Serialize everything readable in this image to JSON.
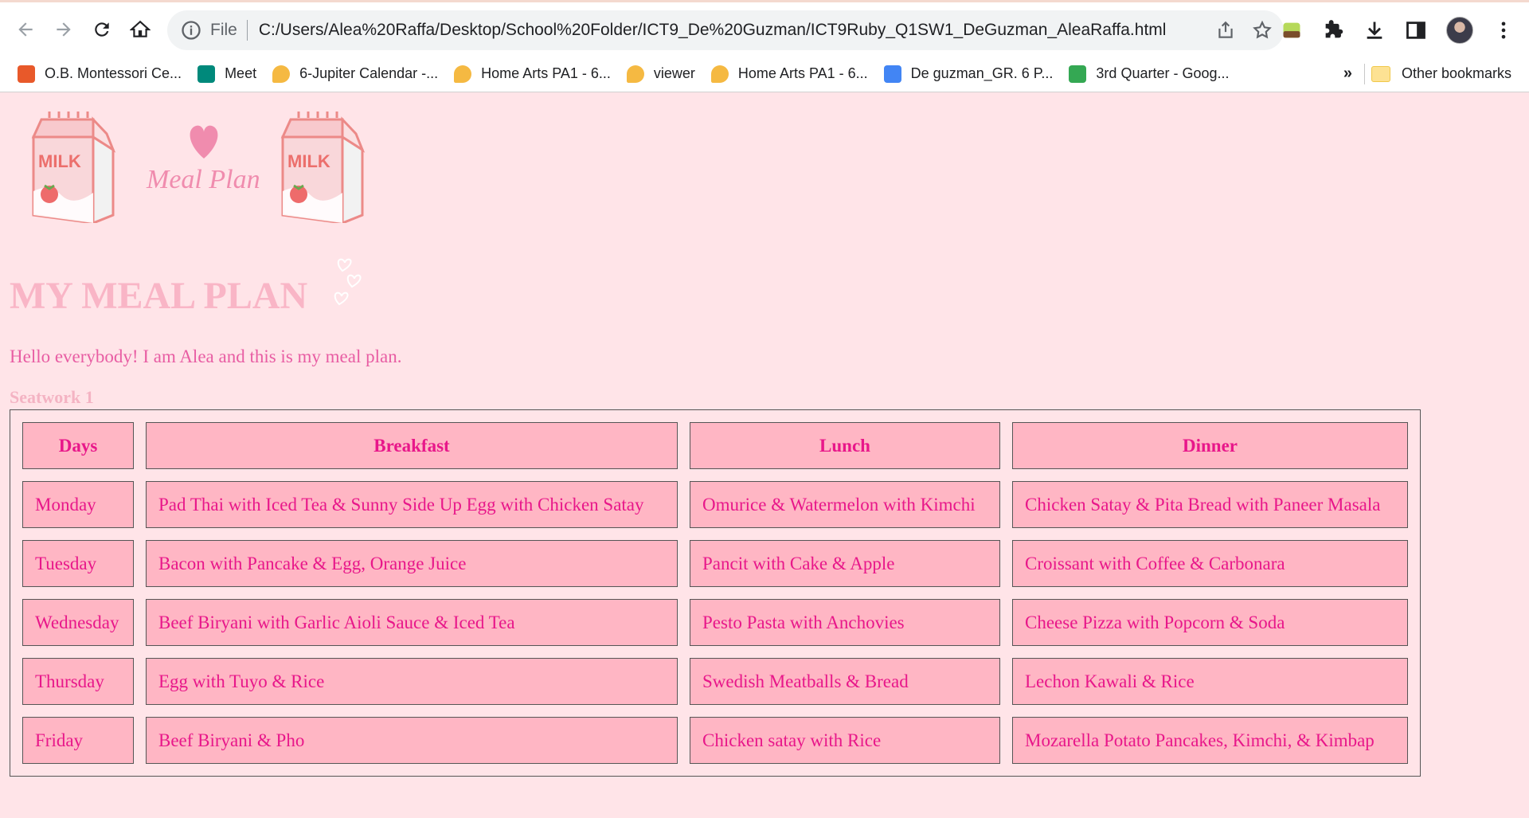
{
  "browser": {
    "file_label": "File",
    "url": "C:/Users/Alea%20Raffa/Desktop/School%20Folder/ICT9_De%20Guzman/ICT9Ruby_Q1SW1_DeGuzman_AleaRaffa.html",
    "bookmarks": [
      {
        "label": "O.B. Montessori Ce...",
        "icon": "montessori-icon",
        "color": "#e8592a"
      },
      {
        "label": "Meet",
        "icon": "meet-icon",
        "color": "#00897b"
      },
      {
        "label": "6-Jupiter Calendar -...",
        "icon": "jupiter-icon",
        "color": "#f5b942"
      },
      {
        "label": "Home Arts PA1 - 6...",
        "icon": "jupiter-icon",
        "color": "#f5b942"
      },
      {
        "label": "viewer",
        "icon": "jupiter-icon",
        "color": "#f5b942"
      },
      {
        "label": "Home Arts PA1 - 6...",
        "icon": "jupiter-icon",
        "color": "#f5b942"
      },
      {
        "label": "De guzman_GR. 6 P...",
        "icon": "docs-icon",
        "color": "#4285f4"
      },
      {
        "label": "3rd Quarter - Goog...",
        "icon": "drive-icon",
        "color": "#34a853"
      }
    ],
    "more_label": "»",
    "other_bookmarks": "Other bookmarks"
  },
  "page": {
    "logo_text": "Meal Plan",
    "carton_text": "MILK",
    "title": "MY MEAL PLAN",
    "intro": "Hello everybody! I am Alea and this is my meal plan.",
    "seatwork": "Seatwork 1",
    "table": {
      "headers": [
        "Days",
        "Breakfast",
        "Lunch",
        "Dinner"
      ],
      "rows": [
        [
          "Monday",
          "Pad Thai with Iced Tea & Sunny Side Up Egg with Chicken Satay",
          "Omurice & Watermelon with Kimchi",
          "Chicken Satay & Pita Bread with Paneer Masala"
        ],
        [
          "Tuesday",
          "Bacon with Pancake & Egg, Orange Juice",
          "Pancit with Cake & Apple",
          "Croissant with Coffee & Carbonara"
        ],
        [
          "Wednesday",
          "Beef Biryani with Garlic Aioli Sauce & Iced Tea",
          "Pesto Pasta with Anchovies",
          "Cheese Pizza with Popcorn & Soda"
        ],
        [
          "Thursday",
          "Egg with Tuyo & Rice",
          "Swedish Meatballs & Bread",
          "Lechon Kawali & Rice"
        ],
        [
          "Friday",
          "Beef Biryani & Pho",
          "Chicken satay with Rice",
          "Mozarella Potato Pancakes, Kimchi, & Kimbap"
        ]
      ]
    }
  },
  "colors": {
    "page_bg": "#ffe4e8",
    "cell_bg": "#ffb6c4",
    "cell_text": "#e8178a",
    "title": "#f9b5c6",
    "intro": "#e85da3"
  }
}
